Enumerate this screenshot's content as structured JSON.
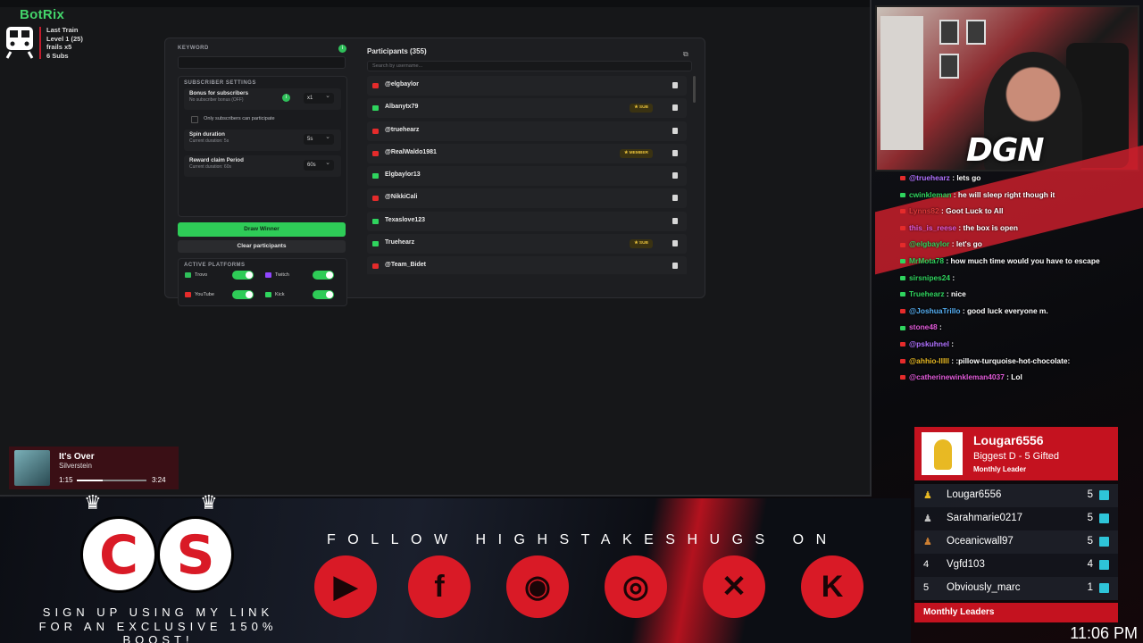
{
  "botrix": {
    "logo": "BotRix",
    "train_title": "Last Train",
    "train_level": "Level 1  (25)",
    "train_frails": "frails x5",
    "train_subs": "6 Subs"
  },
  "giveaway": {
    "keyword_label": "KEYWORD",
    "subscriber_settings_label": "SUBSCRIBER SETTINGS",
    "bonus_title": "Bonus for subscribers",
    "bonus_sub": "No subscriber bonus (OFF)",
    "bonus_value": "x1",
    "only_subs_label": "Only subscribers can participate",
    "spin_title": "Spin duration",
    "spin_sub": "Current duration: 5s",
    "spin_value": "5s",
    "reward_title": "Reward claim Period",
    "reward_sub": "Current duration: 60s",
    "reward_value": "60s",
    "draw_button": "Draw Winner",
    "clear_button": "Clear participants",
    "active_platforms_label": "ACTIVE PLATFORMS",
    "platforms": [
      {
        "name": "Trovo",
        "color": "#2fbf5a",
        "on": true
      },
      {
        "name": "Twitch",
        "color": "#9146ff",
        "on": true
      },
      {
        "name": "YouTube",
        "color": "#e52b2b",
        "on": true
      },
      {
        "name": "Kick",
        "color": "#2fd45e",
        "on": true
      }
    ],
    "participants_title": "Participants (355)",
    "search_placeholder": "Search by username...",
    "participants": [
      {
        "name": "@elgbaylor",
        "platform": "yt",
        "badge": ""
      },
      {
        "name": "Albanytx79",
        "platform": "kick",
        "badge": "★ SUB"
      },
      {
        "name": "@truehearz",
        "platform": "yt",
        "badge": ""
      },
      {
        "name": "@RealWaldo1981",
        "platform": "yt",
        "badge": "★ MEMBER"
      },
      {
        "name": "Elgbaylor13",
        "platform": "kick",
        "badge": ""
      },
      {
        "name": "@NikkiCali",
        "platform": "yt",
        "badge": ""
      },
      {
        "name": "Texaslove123",
        "platform": "kick",
        "badge": ""
      },
      {
        "name": "Truehearz",
        "platform": "kick",
        "badge": "★ SUB"
      },
      {
        "name": "@Team_Bidet",
        "platform": "yt",
        "badge": ""
      }
    ]
  },
  "dgn_logo": "DGN",
  "chat": [
    {
      "platform": "yt",
      "user": "@truehearz",
      "color": "#b071ff",
      "text": " : lets go"
    },
    {
      "platform": "kick",
      "user": "cwinkleman",
      "color": "#2fd45e",
      "text": " : he will sleep right though it"
    },
    {
      "platform": "yt",
      "user": "Lynns82",
      "color": "#e03b3b",
      "text": " : Goot Luck to All"
    },
    {
      "platform": "yt",
      "user": "this_is_reese",
      "color": "#e05ad8",
      "text": " : the box is open"
    },
    {
      "platform": "yt",
      "user": "@elgbaylor",
      "color": "#2fd45e",
      "text": " : let's go"
    },
    {
      "platform": "kick",
      "user": "MrMota78",
      "color": "#2fd45e",
      "text": " : how much time would you have to escape"
    },
    {
      "platform": "kick",
      "user": "sirsnipes24",
      "color": "#2fd45e",
      "text": " : "
    },
    {
      "platform": "kick",
      "user": "Truehearz",
      "color": "#2fd45e",
      "text": " : nice"
    },
    {
      "platform": "yt",
      "user": "@JoshuaTrillo",
      "color": "#55aef2",
      "text": " : good luck everyone m."
    },
    {
      "platform": "kick",
      "user": "stone48",
      "color": "#e05ad8",
      "text": " : "
    },
    {
      "platform": "yt",
      "user": "@pskuhnel",
      "color": "#b071ff",
      "text": " : "
    },
    {
      "platform": "yt",
      "user": "@ahhio-IIIII",
      "color": "#e8b923",
      "text": " : :pillow-turquoise-hot-chocolate:"
    },
    {
      "platform": "yt",
      "user": "@catherinewinkleman4037",
      "color": "#e05ad8",
      "text": " : Lol"
    }
  ],
  "leaderboard": {
    "leader_name": "Lougar6556",
    "leader_sub": "Biggest D - 5 Gifted",
    "leader_tag": "Monthly Leader",
    "rows": [
      {
        "rank": "",
        "name": "Lougar6556",
        "count": "5"
      },
      {
        "rank": "",
        "name": "Sarahmarie0217",
        "count": "5"
      },
      {
        "rank": "",
        "name": "Oceanicwall97",
        "count": "5"
      },
      {
        "rank": "4",
        "name": "Vgfd103",
        "count": "4"
      },
      {
        "rank": "5",
        "name": "Obviously_marc",
        "count": "1"
      }
    ],
    "footer": "Monthly Leaders"
  },
  "clock": "11:06 PM",
  "music": {
    "title": "It's Over",
    "artist": "Silverstein",
    "elapsed": "1:15",
    "total": "3:24",
    "progress": 0.37
  },
  "banner": {
    "follow_text": "FOLLOW HIGHSTAKESHUGS ON",
    "signup_line1": "SIGN UP USING MY LINK",
    "signup_line2": "FOR AN EXCLUSIVE 150% BOOST!",
    "badge_left": "C",
    "badge_right": "S",
    "socials": [
      "youtube-icon",
      "facebook-icon",
      "discord-icon",
      "instagram-icon",
      "x-icon",
      "kick-icon"
    ]
  }
}
